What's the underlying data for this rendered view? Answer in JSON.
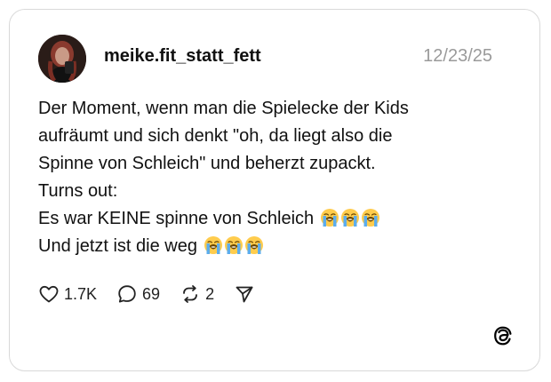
{
  "post": {
    "username": "meike.fit_statt_fett",
    "date": "12/23/25",
    "lines": [
      "Der Moment, wenn man die Spielecke der Kids",
      "aufräumt und sich denkt \"oh, da liegt also die",
      "Spinne von Schleich\" und beherzt zupackt.",
      "Turns out:",
      "Es war KEINE spinne von Schleich",
      "Und jetzt ist die weg"
    ],
    "emoji": "loudly-crying-face"
  },
  "actions": {
    "likes": "1.7K",
    "comments": "69",
    "reposts": "2"
  },
  "icons": {
    "like": "heart-icon",
    "comment": "speech-bubble-icon",
    "repost": "repost-icon",
    "share": "send-icon",
    "brand": "threads-logo-icon"
  }
}
